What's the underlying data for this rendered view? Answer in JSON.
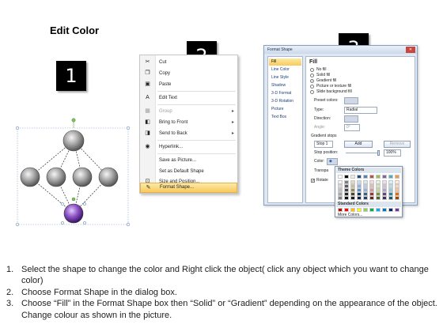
{
  "title": "Edit Color",
  "step_badges": [
    "1",
    "2",
    "3"
  ],
  "context_menu": {
    "items": [
      {
        "label": "Cut",
        "icon": "scissors-icon",
        "glyph": "✂"
      },
      {
        "label": "Copy",
        "icon": "copy-icon",
        "glyph": "❐"
      },
      {
        "label": "Paste",
        "icon": "paste-icon",
        "glyph": "▣"
      },
      {
        "label": "Edit Text",
        "icon": "edit-text-icon",
        "glyph": "A"
      },
      {
        "label": "Group",
        "icon": "group-icon",
        "glyph": "▦"
      },
      {
        "label": "Bring to Front",
        "icon": "bring-front-icon",
        "glyph": "◧"
      },
      {
        "label": "Send to Back",
        "icon": "send-back-icon",
        "glyph": "◨"
      },
      {
        "label": "Hyperlink...",
        "icon": "hyperlink-icon",
        "glyph": "◉"
      },
      {
        "label": "Save as Picture...",
        "icon": "",
        "glyph": ""
      },
      {
        "label": "Set as Default Shape",
        "icon": "",
        "glyph": ""
      },
      {
        "label": "Size and Position...",
        "icon": "size-position-icon",
        "glyph": "⊡"
      },
      {
        "label": "Format Shape...",
        "icon": "format-shape-icon",
        "glyph": "✎"
      }
    ]
  },
  "dialog": {
    "title": "Format Shape",
    "close_glyph": "✕",
    "nav": [
      "Fill",
      "Line Color",
      "Line Style",
      "Shadow",
      "3-D Format",
      "3-D Rotation",
      "Picture",
      "Text Box"
    ],
    "section_title": "Fill",
    "fill_options": [
      "No fill",
      "Solid fill",
      "Gradient fill",
      "Picture or texture fill",
      "Slide background fill"
    ],
    "preset_colors_label": "Preset colors:",
    "type_label": "Type:",
    "type_value": "Radial",
    "direction_label": "Direction:",
    "angle_label": "Angle:",
    "angle_value": "0°",
    "gradient_stops_label": "Gradient stops",
    "stop_value": "Stop 1",
    "add_button": "Add",
    "remove_button": "Remove",
    "stop_position_label": "Stop position:",
    "stop_position_value": "100%",
    "color_label": "Color:",
    "transparency_label": "Transpa",
    "rotate_label": "Rotate"
  },
  "color_popup": {
    "theme_header": "Theme Colors",
    "standard_header": "Standard Colors",
    "more_colors": "More Colors...",
    "theme_top": [
      "#ffffff",
      "#000000",
      "#eeece1",
      "#1f497d",
      "#4f81bd",
      "#c0504d",
      "#9bbb59",
      "#8064a2",
      "#4bacc6",
      "#f79646"
    ],
    "theme_cols": [
      [
        "#f2f2f2",
        "#d9d9d9",
        "#bfbfbf",
        "#a6a6a6",
        "#808080"
      ],
      [
        "#7f7f7f",
        "#595959",
        "#404040",
        "#262626",
        "#0d0d0d"
      ],
      [
        "#ddd9c3",
        "#c4bd97",
        "#938953",
        "#494429",
        "#1d1b10"
      ],
      [
        "#c6d9f0",
        "#8db3e2",
        "#548dd4",
        "#17365d",
        "#0f243e"
      ],
      [
        "#dbe5f1",
        "#b8cce4",
        "#95b3d7",
        "#366092",
        "#244061"
      ],
      [
        "#f2dcdb",
        "#e5b9b7",
        "#d99694",
        "#953734",
        "#632423"
      ],
      [
        "#ebf1dd",
        "#d7e3bc",
        "#c3d69b",
        "#76923c",
        "#4f6128"
      ],
      [
        "#e5e0ec",
        "#ccc1d9",
        "#b2a2c7",
        "#5f497a",
        "#3f3151"
      ],
      [
        "#dbeef3",
        "#b7dde8",
        "#92cddc",
        "#31859b",
        "#205867"
      ],
      [
        "#fdeada",
        "#fbd5b5",
        "#fac08f",
        "#e36c09",
        "#974806"
      ]
    ],
    "standard": [
      "#c00000",
      "#ff0000",
      "#ffc000",
      "#ffff00",
      "#92d050",
      "#00b050",
      "#00b0f0",
      "#0070c0",
      "#002060",
      "#7030a0"
    ]
  },
  "instructions": [
    {
      "num": "1.",
      "text": "Select the shape to change the color and Right click the object( click any object which you want to change color)"
    },
    {
      "num": "2.",
      "text": "Choose Format Shape in the dialog box."
    },
    {
      "num": "3.",
      "text": "Choose “Fill” in the Format Shape box then “Solid” or “Gradient” depending on the appearance of the object. Change colour as shown in the picture."
    }
  ],
  "colors": {
    "sphere_gray": "#9a9a9a",
    "sphere_selected": "#7b3fb3",
    "highlight": "#f9c95c"
  }
}
